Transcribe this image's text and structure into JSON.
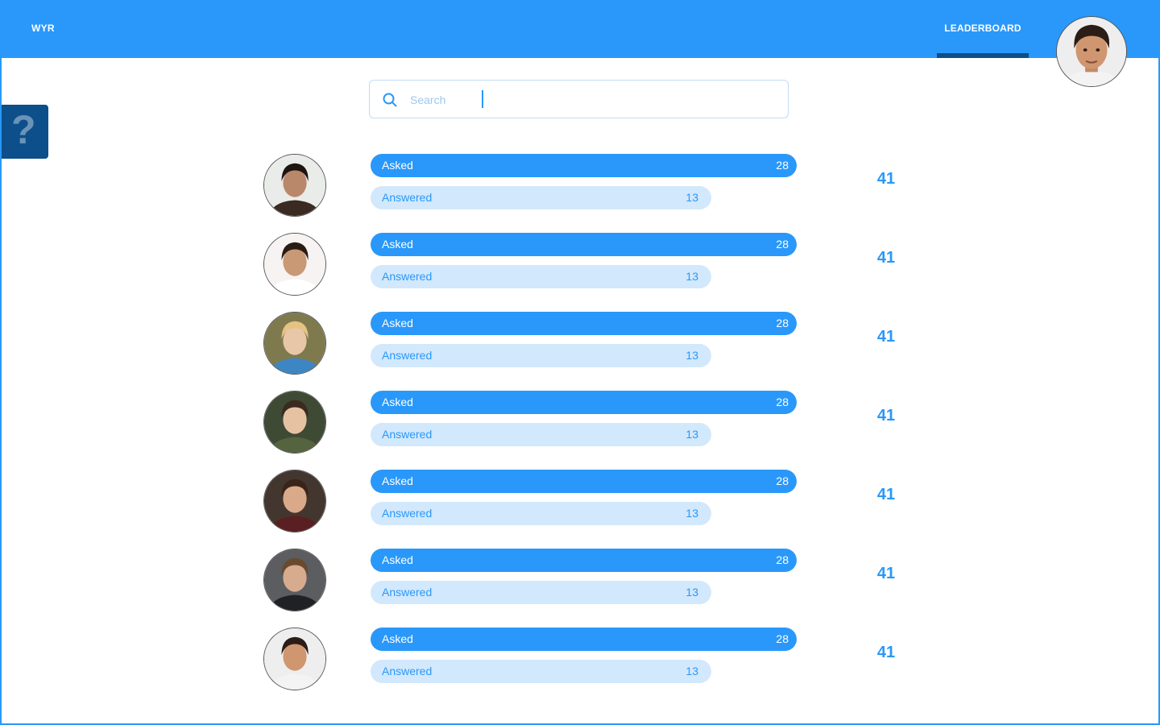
{
  "app": {
    "brand": "WYR"
  },
  "nav": {
    "leaderboard": "LEADERBOARD"
  },
  "help": {
    "glyph": "?"
  },
  "search": {
    "placeholder": "Search",
    "value": ""
  },
  "colors": {
    "primary": "#2998fa",
    "dark": "#0d4f8a",
    "light": "#d2e8fc"
  },
  "leaderboard": [
    {
      "asked_label": "Asked",
      "asked": "28",
      "answered_label": "Answered",
      "answered": "13",
      "total": "41"
    },
    {
      "asked_label": "Asked",
      "asked": "28",
      "answered_label": "Answered",
      "answered": "13",
      "total": "41"
    },
    {
      "asked_label": "Asked",
      "asked": "28",
      "answered_label": "Answered",
      "answered": "13",
      "total": "41"
    },
    {
      "asked_label": "Asked",
      "asked": "28",
      "answered_label": "Answered",
      "answered": "13",
      "total": "41"
    },
    {
      "asked_label": "Asked",
      "asked": "28",
      "answered_label": "Answered",
      "answered": "13",
      "total": "41"
    },
    {
      "asked_label": "Asked",
      "asked": "28",
      "answered_label": "Answered",
      "answered": "13",
      "total": "41"
    },
    {
      "asked_label": "Asked",
      "asked": "28",
      "answered_label": "Answered",
      "answered": "13",
      "total": "41"
    }
  ]
}
